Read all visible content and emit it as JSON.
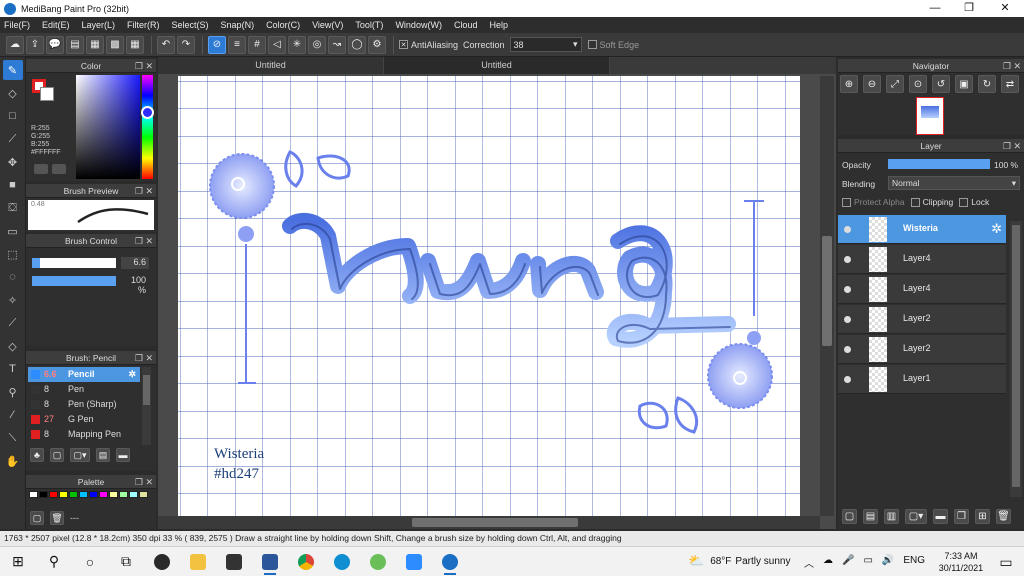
{
  "window": {
    "title": "MediBang Paint Pro (32bit)",
    "controls": [
      "—",
      "❐",
      "✕"
    ]
  },
  "menu": [
    "File(F)",
    "Edit(E)",
    "Layer(L)",
    "Filter(R)",
    "Select(S)",
    "Snap(N)",
    "Color(C)",
    "View(V)",
    "Tool(T)",
    "Window(W)",
    "Cloud",
    "Help"
  ],
  "toolbar": {
    "antialiasing_label": "AntiAliasing",
    "correction_label": "Correction",
    "correction_value": "38",
    "soft_edge_label": "Soft Edge"
  },
  "color_panel": {
    "title": "Color",
    "rgb": [
      "R:255",
      "G:255",
      "B:255"
    ],
    "hex": "#FFFFFF",
    "primary_color": "#e02020"
  },
  "brush_preview": {
    "title": "Brush Preview",
    "size_label": "0.48"
  },
  "brush_control": {
    "title": "Brush Control",
    "size_value": "6.6",
    "opacity_value": "100 %"
  },
  "brush_list": {
    "title": "Brush: Pencil",
    "items": [
      {
        "size": "6.6",
        "name": "Pencil",
        "color": "#2d8cff"
      },
      {
        "size": "8",
        "name": "Pen",
        "color": "#333333"
      },
      {
        "size": "8",
        "name": "Pen (Sharp)",
        "color": "#333333"
      },
      {
        "size": "27",
        "name": "G Pen",
        "color": "#e02020"
      },
      {
        "size": "8",
        "name": "Mapping Pen",
        "color": "#e02020"
      }
    ]
  },
  "palette": {
    "title": "Palette",
    "more": "---",
    "colors": [
      "#ffffff",
      "#000000",
      "#ff0000",
      "#ffff00",
      "#00c000",
      "#00c0ff",
      "#0000ff",
      "#ff00ff",
      "#ffffa0",
      "#a0ffa0",
      "#a0ffff",
      "#e0e0a0"
    ]
  },
  "tabs": [
    "Untitled",
    "Untitled"
  ],
  "canvas": {
    "artwork_text": "Bung",
    "caption_line1": "Wisteria",
    "caption_line2": "#hd247"
  },
  "navigator": {
    "title": "Navigator"
  },
  "layer_panel": {
    "title": "Layer",
    "opacity_label": "Opacity",
    "opacity_value": "100 %",
    "blending_label": "Blending",
    "blending_value": "Normal",
    "protect_alpha_label": "Protect Alpha",
    "clipping_label": "Clipping",
    "lock_label": "Lock",
    "layers": [
      "Wisteria",
      "Layer4",
      "Layer4",
      "Layer2",
      "Layer2",
      "Layer1"
    ]
  },
  "status_bar": {
    "text": "1763 * 2507 pixel   (12.8 * 18.2cm)   350 dpi    33 %   ( 839, 2575 )   Draw a straight line by holding down Shift, Change a brush size by holding down Ctrl, Alt, and dragging"
  },
  "taskbar": {
    "weather_temp": "68°F",
    "weather_desc": "Partly sunny",
    "lang": "ENG",
    "time": "7:33 AM",
    "date": "30/11/2021"
  }
}
